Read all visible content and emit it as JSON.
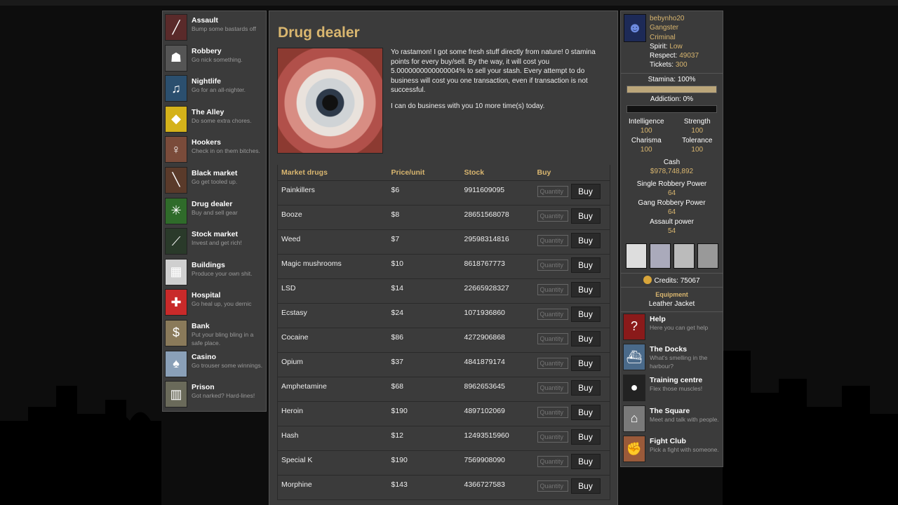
{
  "colors": {
    "accent": "#d9b66f",
    "panel": "#3b3b3b",
    "background": "#0d0d0d"
  },
  "left_nav": [
    {
      "title": "Assault",
      "desc": "Bump some bastards off",
      "icon": "crowbar-icon",
      "glyph": "╱",
      "color": "#5a2a2a"
    },
    {
      "title": "Robbery",
      "desc": "Go nick something.",
      "icon": "robber-icon",
      "glyph": "☗",
      "color": "#555"
    },
    {
      "title": "Nightlife",
      "desc": "Go for an all-nighter.",
      "icon": "crowd-icon",
      "glyph": "♫",
      "color": "#2b4f6e"
    },
    {
      "title": "The Alley",
      "desc": "Do some extra chores.",
      "icon": "sign-icon",
      "glyph": "◆",
      "color": "#d4b21a"
    },
    {
      "title": "Hookers",
      "desc": "Check in on them bitches.",
      "icon": "legs-icon",
      "glyph": "♀",
      "color": "#7a4b3a"
    },
    {
      "title": "Black market",
      "desc": "Go get tooled up.",
      "icon": "gun-icon",
      "glyph": "╲",
      "color": "#5a3a2a"
    },
    {
      "title": "Drug dealer",
      "desc": "Buy and sell gear",
      "icon": "leaf-icon",
      "glyph": "✳",
      "color": "#2f6b2a"
    },
    {
      "title": "Stock market",
      "desc": "Invest and get rich!",
      "icon": "chart-icon",
      "glyph": "⟋",
      "color": "#2a3a2a"
    },
    {
      "title": "Buildings",
      "desc": "Produce your own shit.",
      "icon": "building-icon",
      "glyph": "▦",
      "color": "#cfcfcf"
    },
    {
      "title": "Hospital",
      "desc": "Go heal up, you dernic",
      "icon": "cross-icon",
      "glyph": "✚",
      "color": "#c92a2a"
    },
    {
      "title": "Bank",
      "desc": "Put your bling bling in a safe place.",
      "icon": "moneybag-icon",
      "glyph": "$",
      "color": "#8a7a5a"
    },
    {
      "title": "Casino",
      "desc": "Go trouser some winnings.",
      "icon": "cards-icon",
      "glyph": "♠",
      "color": "#8aa0b8"
    },
    {
      "title": "Prison",
      "desc": "Got narked? Hard-lines!",
      "icon": "prisoner-icon",
      "glyph": "▥",
      "color": "#6a6a5a"
    }
  ],
  "main": {
    "title": "Drug dealer",
    "intro_1": "Yo rastamon! I got some fresh stuff directly from nature! 0 stamina points for every buy/sell. By the way, it will cost you 5.0000000000000004% to sell your stash. Every attempt to do business will cost you one transaction, even if transaction is not successful.",
    "intro_2": "I can do business with you 10 more time(s) today.",
    "table": {
      "headers": [
        "Market drugs",
        "Price/unit",
        "Stock",
        "Buy"
      ],
      "qty_placeholder": "Quantity",
      "buy_label": "Buy",
      "rows": [
        [
          "Painkillers",
          "$6",
          "9911609095"
        ],
        [
          "Booze",
          "$8",
          "28651568078"
        ],
        [
          "Weed",
          "$7",
          "29598314816"
        ],
        [
          "Magic mushrooms",
          "$10",
          "8618767773"
        ],
        [
          "LSD",
          "$14",
          "22665928327"
        ],
        [
          "Ecstasy",
          "$24",
          "1071936860"
        ],
        [
          "Cocaine",
          "$86",
          "4272906868"
        ],
        [
          "Opium",
          "$37",
          "4841879174"
        ],
        [
          "Amphetamine",
          "$68",
          "8962653645"
        ],
        [
          "Heroin",
          "$190",
          "4897102069"
        ],
        [
          "Hash",
          "$12",
          "12493515960"
        ],
        [
          "Special K",
          "$190",
          "7569908090"
        ],
        [
          "Morphine",
          "$143",
          "4366727583"
        ]
      ]
    }
  },
  "profile": {
    "name": "bebynho20",
    "rank": "Gangster",
    "class": "Criminal",
    "spirit_label": "Spirit:",
    "spirit": "Low",
    "respect_label": "Respect:",
    "respect": "49037",
    "tickets_label": "Tickets:",
    "tickets": "300"
  },
  "stats": {
    "stamina_label": "Stamina: 100%",
    "stamina": 100,
    "addiction_label": "Addiction: 0%",
    "addiction": 0,
    "intelligence_label": "Intelligence",
    "intelligence": "100",
    "strength_label": "Strength",
    "strength": "100",
    "charisma_label": "Charisma",
    "charisma": "100",
    "tolerance_label": "Tolerance",
    "tolerance": "100",
    "cash_label": "Cash",
    "cash": "$978,748,892",
    "single_label": "Single Robbery Power",
    "single": "64",
    "gang_label": "Gang Robbery Power",
    "gang": "64",
    "assault_label": "Assault power",
    "assault": "54",
    "credits": "Credits: 75067",
    "equipment_label": "Equipment",
    "equipment": "Leather Jacket"
  },
  "right_nav": [
    {
      "title": "Help",
      "desc": "Here you can get help",
      "icon": "question-icon",
      "glyph": "?",
      "color": "#8a1a1a"
    },
    {
      "title": "The Docks",
      "desc": "What's smelling in the harbour?",
      "icon": "ship-icon",
      "glyph": "⛴",
      "color": "#4a6a8a"
    },
    {
      "title": "Training centre",
      "desc": "Flex those muscles!",
      "icon": "weight-icon",
      "glyph": "●",
      "color": "#222"
    },
    {
      "title": "The Square",
      "desc": "Meet and talk with people.",
      "icon": "square-icon",
      "glyph": "⌂",
      "color": "#7a7a7a"
    },
    {
      "title": "Fight Club",
      "desc": "Pick a fight with someone.",
      "icon": "fist-icon",
      "glyph": "✊",
      "color": "#9a5a3a"
    }
  ]
}
